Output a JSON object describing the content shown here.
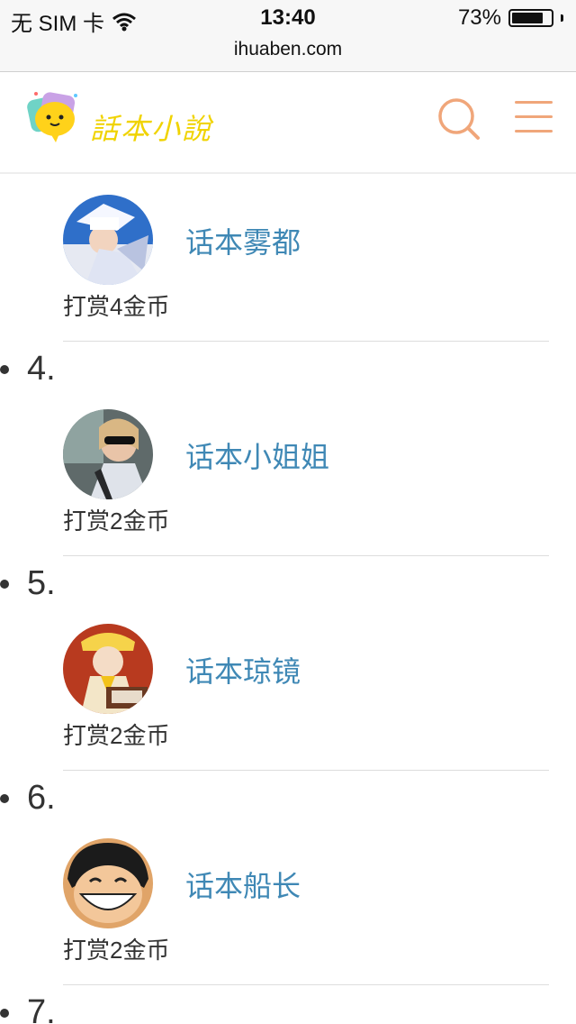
{
  "status_bar": {
    "carrier": "无 SIM 卡",
    "time": "13:40",
    "battery": "73%",
    "battery_level": 0.73
  },
  "browser": {
    "url": "ihuaben.com"
  },
  "header": {
    "logo_text": "話本小說",
    "logo_icon": "speech-bubble-logo-icon",
    "search_icon": "search-icon",
    "menu_icon": "hamburger-menu-icon"
  },
  "entries": [
    {
      "name": "话本雾都",
      "reward": "打赏4金币"
    },
    {
      "rank": "4.",
      "name": "话本小姐姐",
      "reward": "打赏2金币"
    },
    {
      "rank": "5.",
      "name": "话本琼镜",
      "reward": "打赏2金币"
    },
    {
      "rank": "6.",
      "name": "话本船长",
      "reward": "打赏2金币"
    },
    {
      "rank": "7."
    }
  ],
  "colors": {
    "link": "#3f88b5",
    "accent": "#f0a67a",
    "logo": "#f0d300"
  }
}
